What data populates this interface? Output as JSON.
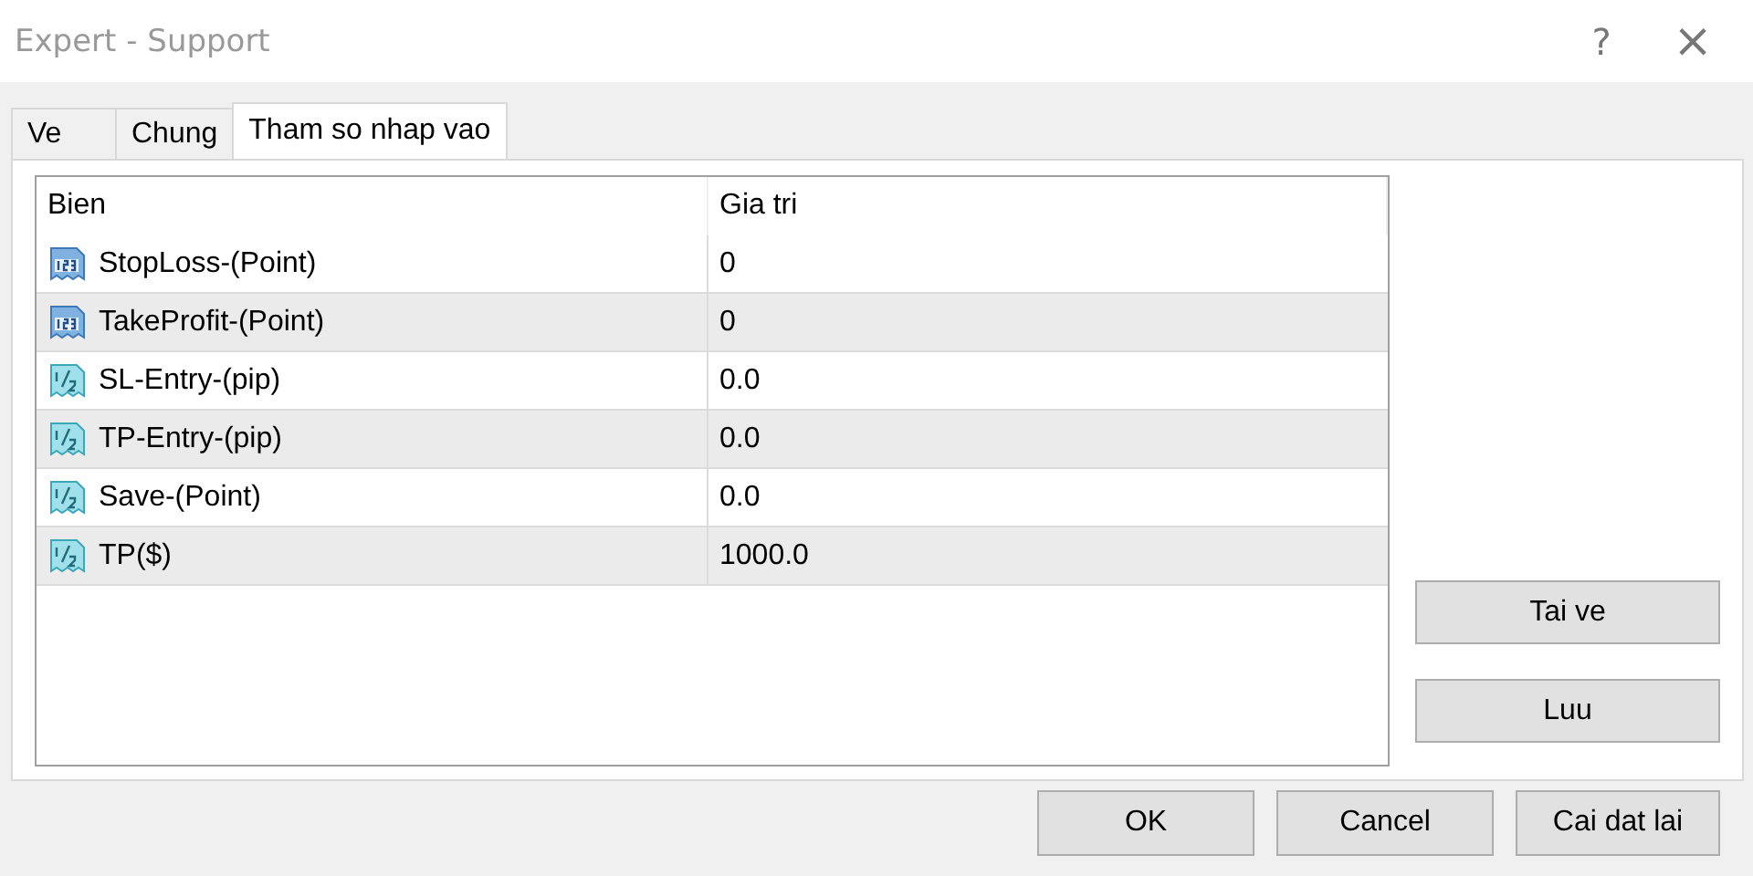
{
  "window": {
    "title": "Expert - Support",
    "help": "?",
    "close": "×"
  },
  "tabs": [
    {
      "label": "Ve",
      "selected": false
    },
    {
      "label": "Chung",
      "selected": false
    },
    {
      "label": "Tham so nhap vao",
      "selected": true
    }
  ],
  "table": {
    "columns": [
      "Bien",
      "Gia tri"
    ],
    "rows": [
      {
        "kind": "integer",
        "name": "StopLoss-(Point)",
        "value": "0"
      },
      {
        "kind": "integer",
        "name": "TakeProfit-(Point)",
        "value": "0"
      },
      {
        "kind": "double",
        "name": "SL-Entry-(pip)",
        "value": "0.0"
      },
      {
        "kind": "double",
        "name": "TP-Entry-(pip)",
        "value": "0.0"
      },
      {
        "kind": "double",
        "name": "Save-(Point)",
        "value": "0.0"
      },
      {
        "kind": "double",
        "name": "TP($)",
        "value": "1000.0"
      }
    ]
  },
  "side_buttons": [
    "Tai ve",
    "Luu"
  ],
  "buttons": [
    "OK",
    "Cancel",
    "Cai dat lai"
  ]
}
